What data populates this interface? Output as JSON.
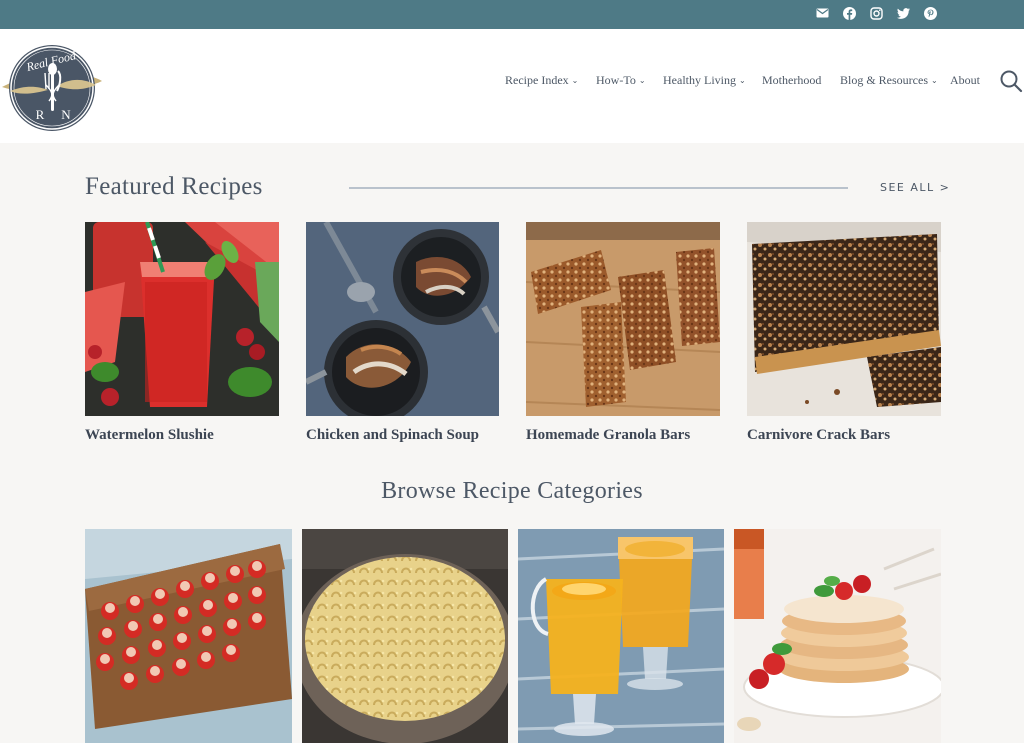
{
  "topbar": {
    "social_icons": [
      "email-icon",
      "facebook-icon",
      "instagram-icon",
      "twitter-icon",
      "pinterest-icon"
    ]
  },
  "logo": {
    "text_top": "Real Food",
    "initial_left": "R",
    "initial_right": "N"
  },
  "nav": {
    "items": [
      {
        "label": "Recipe Index",
        "has_dropdown": true
      },
      {
        "label": "How-To",
        "has_dropdown": true
      },
      {
        "label": "Healthy Living",
        "has_dropdown": true
      },
      {
        "label": "Motherhood",
        "has_dropdown": false
      },
      {
        "label": "Blog & Resources",
        "has_dropdown": true
      },
      {
        "label": "About",
        "has_dropdown": false
      }
    ],
    "chevron": "⌄"
  },
  "featured": {
    "title": "Featured Recipes",
    "see_all": "SEE ALL >",
    "recipes": [
      {
        "title": "Watermelon Slushie"
      },
      {
        "title": "Chicken and Spinach Soup"
      },
      {
        "title": "Homemade Granola Bars"
      },
      {
        "title": "Carnivore Crack Bars"
      }
    ]
  },
  "browse": {
    "title": "Browse Recipe Categories"
  },
  "colors": {
    "topbar": "#4e7a86",
    "page_background": "#f7f6f4",
    "text": "#4d5866",
    "logo_navy": "#4a5666",
    "logo_gold": "#c9b27a"
  }
}
